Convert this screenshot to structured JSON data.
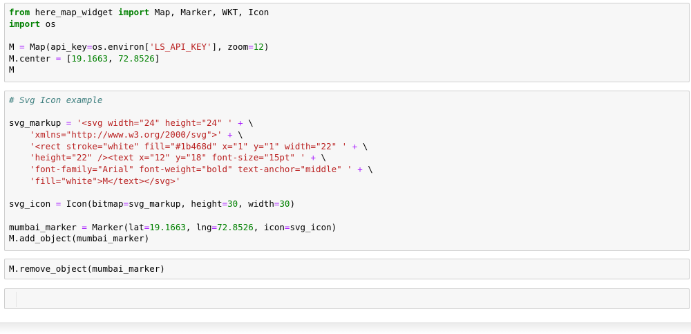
{
  "cells": [
    {
      "type": "code",
      "lines": [
        [
          [
            "keyword",
            "from"
          ],
          [
            "name",
            " here_map_widget "
          ],
          [
            "keyword",
            "import"
          ],
          [
            "name",
            " Map, Marker, WKT, Icon"
          ]
        ],
        [
          [
            "keyword",
            "import"
          ],
          [
            "name",
            " os"
          ]
        ],
        [
          [
            "name",
            ""
          ]
        ],
        [
          [
            "name",
            "M "
          ],
          [
            "operator",
            "="
          ],
          [
            "name",
            " Map(api_key"
          ],
          [
            "operator",
            "="
          ],
          [
            "name",
            "os.environ["
          ],
          [
            "string",
            "'LS_API_KEY'"
          ],
          [
            "name",
            "], zoom"
          ],
          [
            "operator",
            "="
          ],
          [
            "number",
            "12"
          ],
          [
            "name",
            ")"
          ]
        ],
        [
          [
            "name",
            "M.center "
          ],
          [
            "operator",
            "="
          ],
          [
            "name",
            " ["
          ],
          [
            "number",
            "19.1663"
          ],
          [
            "name",
            ", "
          ],
          [
            "number",
            "72.8526"
          ],
          [
            "name",
            "]"
          ]
        ],
        [
          [
            "name",
            "M"
          ]
        ]
      ]
    },
    {
      "type": "code",
      "lines": [
        [
          [
            "comment",
            "# Svg Icon example"
          ]
        ],
        [
          [
            "name",
            ""
          ]
        ],
        [
          [
            "name",
            "svg_markup "
          ],
          [
            "operator",
            "="
          ],
          [
            "name",
            " "
          ],
          [
            "string",
            "'<svg width=\"24\" height=\"24\" '"
          ],
          [
            "name",
            " "
          ],
          [
            "operator",
            "+"
          ],
          [
            "name",
            " \\"
          ]
        ],
        [
          [
            "name",
            "    "
          ],
          [
            "string",
            "'xmlns=\"http://www.w3.org/2000/svg\">'"
          ],
          [
            "name",
            " "
          ],
          [
            "operator",
            "+"
          ],
          [
            "name",
            " \\"
          ]
        ],
        [
          [
            "name",
            "    "
          ],
          [
            "string",
            "'<rect stroke=\"white\" fill=\"#1b468d\" x=\"1\" y=\"1\" width=\"22\" '"
          ],
          [
            "name",
            " "
          ],
          [
            "operator",
            "+"
          ],
          [
            "name",
            " \\"
          ]
        ],
        [
          [
            "name",
            "    "
          ],
          [
            "string",
            "'height=\"22\" /><text x=\"12\" y=\"18\" font-size=\"15pt\" '"
          ],
          [
            "name",
            " "
          ],
          [
            "operator",
            "+"
          ],
          [
            "name",
            " \\"
          ]
        ],
        [
          [
            "name",
            "    "
          ],
          [
            "string",
            "'font-family=\"Arial\" font-weight=\"bold\" text-anchor=\"middle\" '"
          ],
          [
            "name",
            " "
          ],
          [
            "operator",
            "+"
          ],
          [
            "name",
            " \\"
          ]
        ],
        [
          [
            "name",
            "    "
          ],
          [
            "string",
            "'fill=\"white\">M</text></svg>'"
          ]
        ],
        [
          [
            "name",
            ""
          ]
        ],
        [
          [
            "name",
            "svg_icon "
          ],
          [
            "operator",
            "="
          ],
          [
            "name",
            " Icon(bitmap"
          ],
          [
            "operator",
            "="
          ],
          [
            "name",
            "svg_markup, height"
          ],
          [
            "operator",
            "="
          ],
          [
            "number",
            "30"
          ],
          [
            "name",
            ", width"
          ],
          [
            "operator",
            "="
          ],
          [
            "number",
            "30"
          ],
          [
            "name",
            ")"
          ]
        ],
        [
          [
            "name",
            ""
          ]
        ],
        [
          [
            "name",
            "mumbai_marker "
          ],
          [
            "operator",
            "="
          ],
          [
            "name",
            " Marker(lat"
          ],
          [
            "operator",
            "="
          ],
          [
            "number",
            "19.1663"
          ],
          [
            "name",
            ", lng"
          ],
          [
            "operator",
            "="
          ],
          [
            "number",
            "72.8526"
          ],
          [
            "name",
            ", icon"
          ],
          [
            "operator",
            "="
          ],
          [
            "name",
            "svg_icon)"
          ]
        ],
        [
          [
            "name",
            "M.add_object(mumbai_marker)"
          ]
        ]
      ]
    },
    {
      "type": "code",
      "lines": [
        [
          [
            "name",
            "M.remove_object(mumbai_marker)"
          ]
        ]
      ]
    },
    {
      "type": "code",
      "lines": []
    }
  ]
}
